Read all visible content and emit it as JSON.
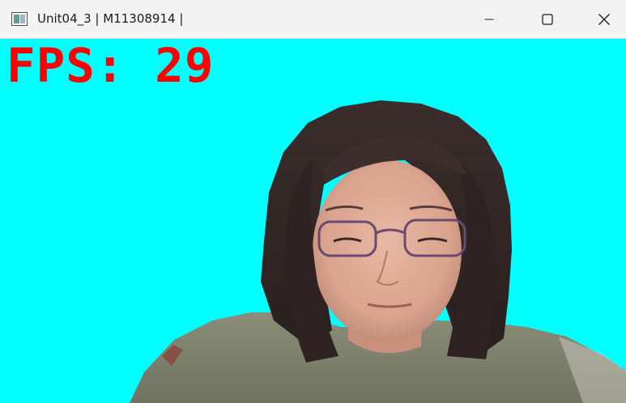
{
  "window": {
    "title": "Unit04_3 | M11308914 |",
    "app_icon": "opencv-window-icon",
    "controls": {
      "minimize_icon": "minimize-icon",
      "maximize_icon": "maximize-icon",
      "close_icon": "close-icon"
    }
  },
  "video": {
    "background_color": "#00ffff",
    "fps_text": "FPS: 29",
    "fps_color": "#ff0000"
  }
}
